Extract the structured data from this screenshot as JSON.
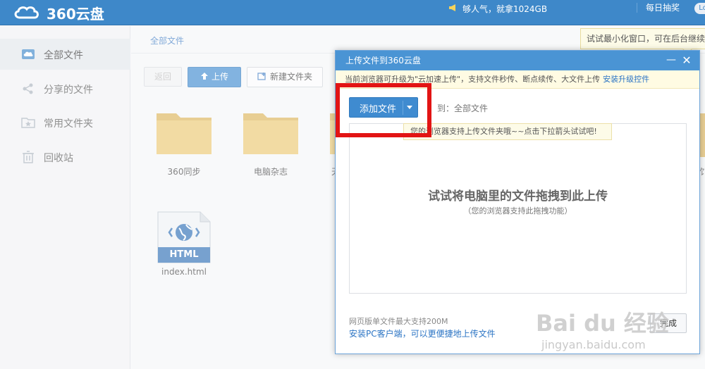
{
  "header": {
    "logo_text": "360云盘",
    "promo": "够人气，就拿1024GB",
    "daily_draw": "每日抽奖",
    "avatar": "Lo"
  },
  "sidebar": {
    "items": [
      {
        "label": "全部文件",
        "icon": "cloud-icon",
        "active": true
      },
      {
        "label": "分享的文件",
        "icon": "share-icon"
      },
      {
        "label": "常用文件夹",
        "icon": "star-folder-icon"
      },
      {
        "label": "回收站",
        "icon": "trash-icon"
      }
    ]
  },
  "main": {
    "breadcrumb": "全部文件",
    "toolbar": {
      "back": "返回",
      "upload": "上传",
      "new_folder": "新建文件夹"
    },
    "files": [
      {
        "name": "360同步",
        "type": "folder"
      },
      {
        "name": "电脑杂志",
        "type": "folder"
      },
      {
        "name": "天",
        "type": "folder"
      },
      {
        "name": "index.html",
        "type": "html",
        "badge": "HTML"
      }
    ],
    "right_edge_partial": "饣"
  },
  "tips": {
    "minimize_tip": "试试最小化窗口，可在后台继续上"
  },
  "dialog": {
    "title": "上传文件到360云盘",
    "minimize": "—",
    "close": "✕",
    "notice": "当前浏览器可升级为\"云加速上传\"，支持文件秒传、断点续传、大文件上传",
    "notice_link": "安装升级控件",
    "add_button": "添加文件",
    "destination": "到：全部文件",
    "folder_tip": "您的浏览器支持上传文件夹哦~~点击下拉箭头试试吧!",
    "dropzone_title": "试试将电脑里的文件拖拽到此上传",
    "dropzone_subtitle": "（您的浏览器支持此拖拽功能）",
    "limit_text": "网页版单文件最大支持200M",
    "pc_link": "安装PC客户端，可以更便捷地上传文件",
    "done_button": "完成"
  },
  "watermark": {
    "brand": "Bai du 经验",
    "url": "jingyan.baidu.com"
  },
  "colors": {
    "primary_blue": "#3e88c9",
    "button_blue": "#3f8bd0",
    "highlight_red": "#e21414",
    "folder_yellow": "#e8c46d"
  }
}
